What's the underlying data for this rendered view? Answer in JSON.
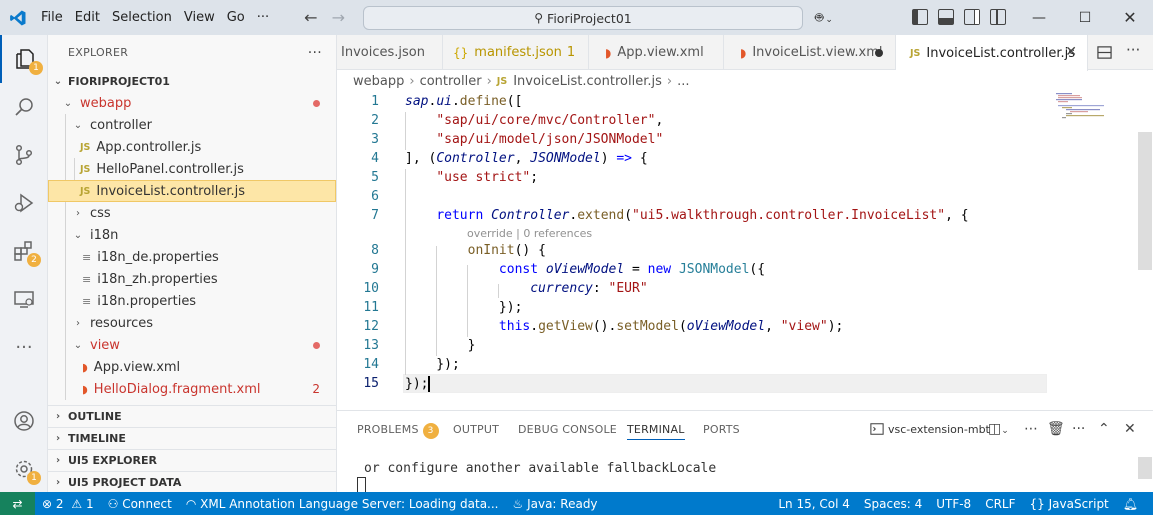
{
  "titlebar": {
    "menu": [
      "File",
      "Edit",
      "Selection",
      "View",
      "Go"
    ],
    "search_text": "FioriProject01"
  },
  "sidebar": {
    "title": "EXPLORER",
    "project": "FIORIPROJECT01",
    "tree": {
      "webapp": "webapp",
      "controller": "controller",
      "app_controller": "App.controller.js",
      "hellopanel_controller": "HelloPanel.controller.js",
      "invoicelist_controller": "InvoiceList.controller.js",
      "css": "css",
      "i18n": "i18n",
      "i18n_de": "i18n_de.properties",
      "i18n_zh": "i18n_zh.properties",
      "i18n_props": "i18n.properties",
      "resources": "resources",
      "view": "view",
      "app_view": "App.view.xml",
      "hellodialog": "HelloDialog.fragment.xml",
      "hellodialog_count": "2"
    },
    "sections": [
      "OUTLINE",
      "TIMELINE",
      "UI5 EXPLORER",
      "UI5 PROJECT DATA"
    ]
  },
  "activity": {
    "explorer_badge": "1",
    "extensions_badge": "2",
    "settings_badge": "1"
  },
  "tabs": [
    {
      "label": "Invoices.json"
    },
    {
      "label": "manifest.json",
      "suffix": "1"
    },
    {
      "label": "App.view.xml"
    },
    {
      "label": "InvoiceList.view.xml"
    },
    {
      "label": "InvoiceList.controller.js"
    }
  ],
  "breadcrumb": [
    "webapp",
    "controller",
    "InvoiceList.controller.js",
    "..."
  ],
  "code": {
    "line_numbers": [
      "1",
      "2",
      "3",
      "4",
      "5",
      "6",
      "7",
      "8",
      "9",
      "10",
      "11",
      "12",
      "13",
      "14",
      "15"
    ],
    "codelens": "override | 0 references"
  },
  "panel": {
    "tabs": [
      "PROBLEMS",
      "OUTPUT",
      "DEBUG CONSOLE",
      "TERMINAL",
      "PORTS"
    ],
    "problems_badge": "3",
    "terminal_name": "vsc-extension-mbt",
    "terminal_line": "or configure another available fallbackLocale"
  },
  "status": {
    "errors": "2",
    "warnings": "1",
    "connect": "Connect",
    "xml_server": "XML Annotation Language Server: Loading data...",
    "java": "Java: Ready",
    "position": "Ln 15, Col 4",
    "spaces": "Spaces: 4",
    "encoding": "UTF-8",
    "eol": "CRLF",
    "language": "JavaScript"
  }
}
